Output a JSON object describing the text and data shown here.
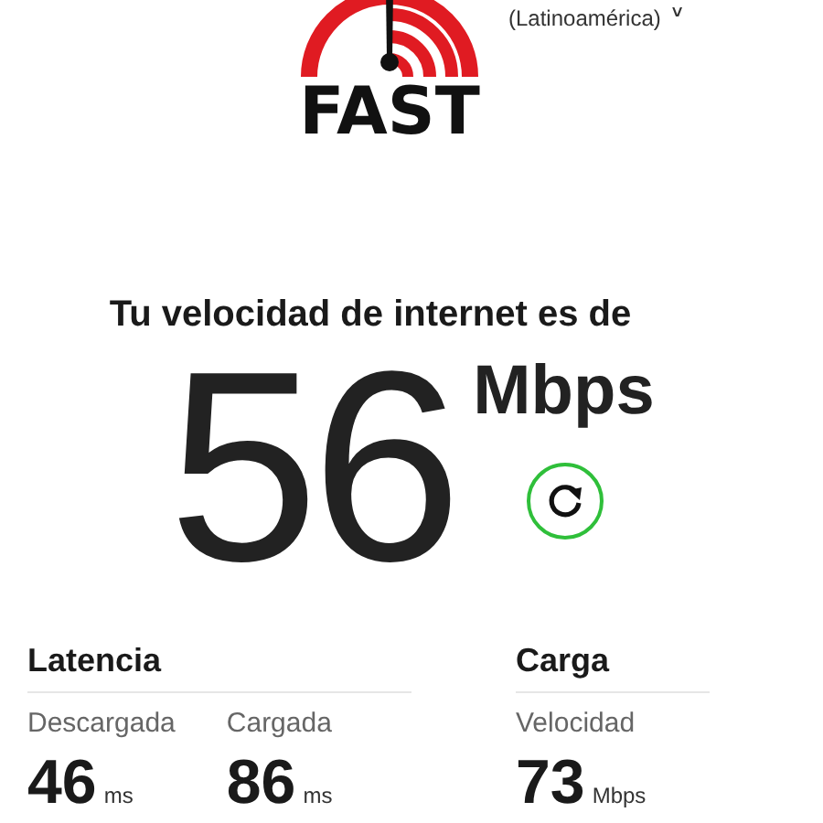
{
  "header": {
    "logo_text": "FAST",
    "language": "(Latinoamérica)",
    "language_caret": "˅"
  },
  "headline": "Tu velocidad de internet es de",
  "speed": {
    "value": "56",
    "unit": "Mbps"
  },
  "sections": [
    {
      "title": "Latencia",
      "metrics": [
        {
          "label": "Descargada",
          "value": "46",
          "unit": "ms"
        },
        {
          "label": "Cargada",
          "value": "86",
          "unit": "ms"
        }
      ]
    },
    {
      "title": "Carga",
      "metrics": [
        {
          "label": "Velocidad",
          "value": "73",
          "unit": "Mbps"
        }
      ]
    }
  ]
}
